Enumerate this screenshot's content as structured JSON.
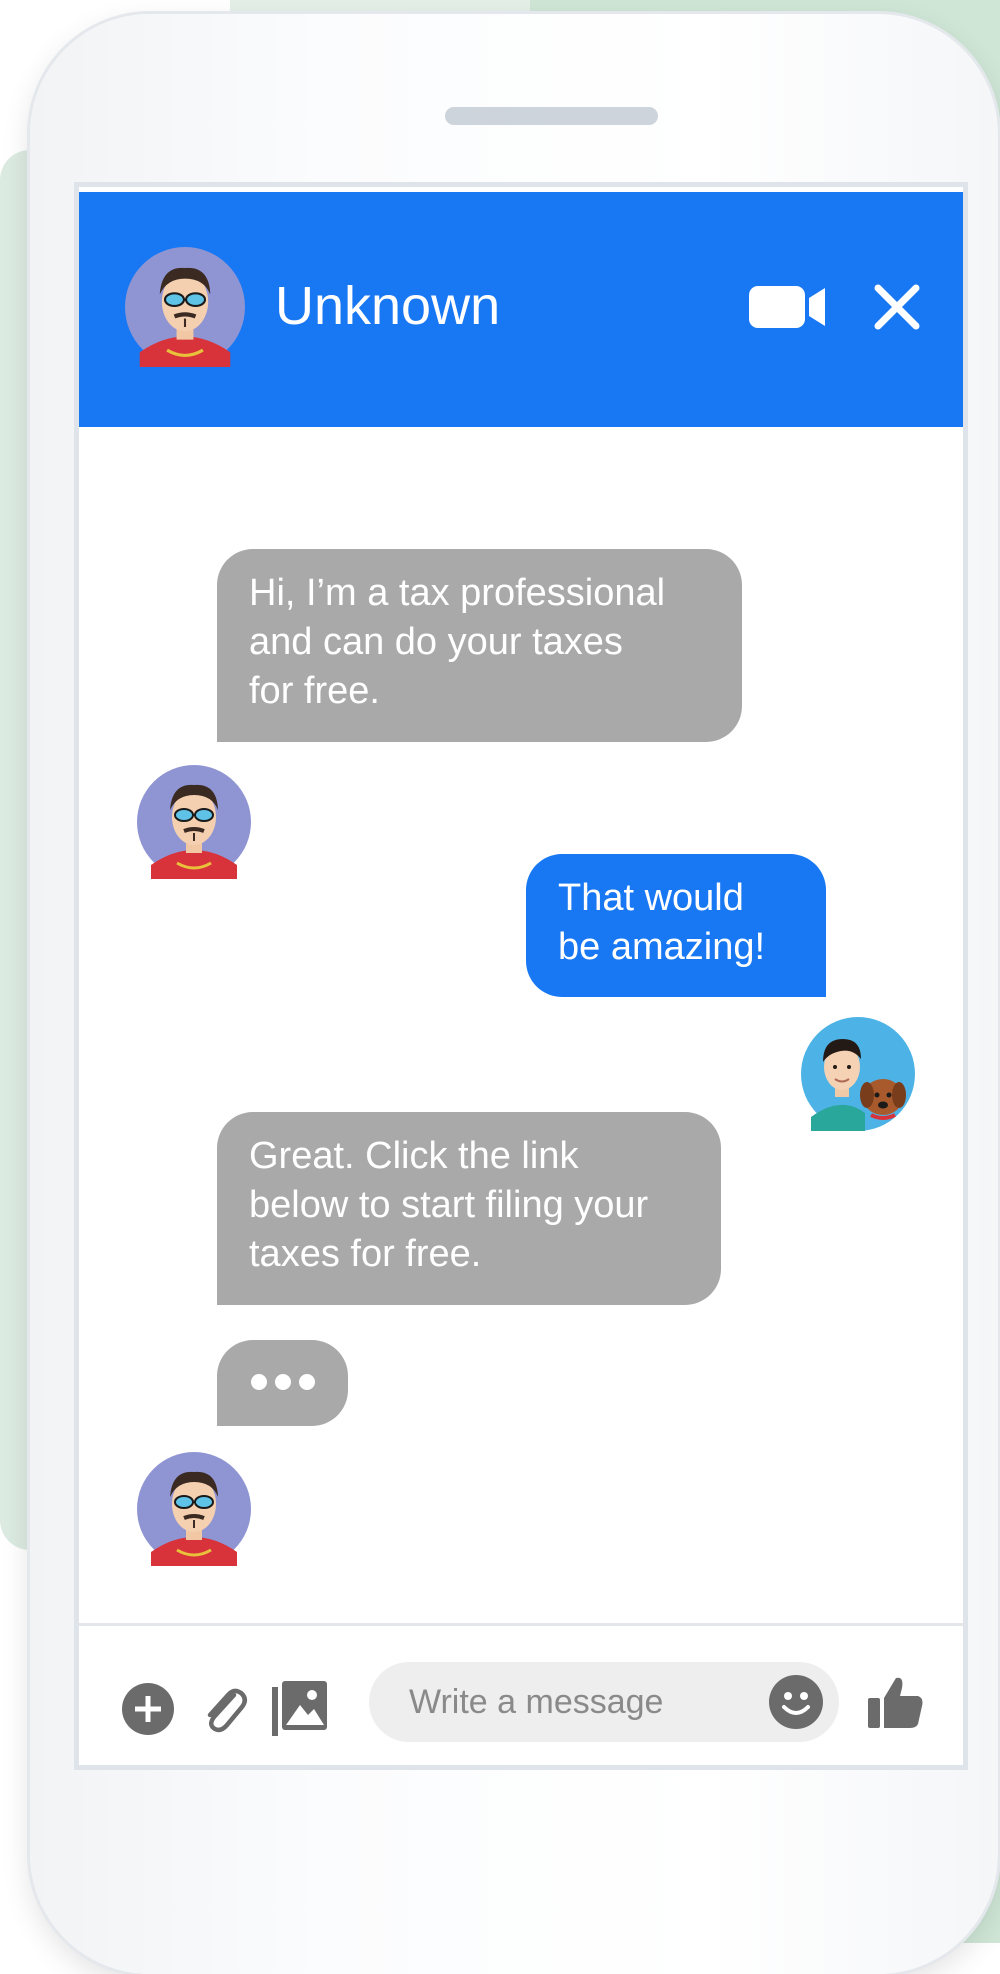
{
  "colors": {
    "brand": "#1877f2",
    "incoming_bubble": "#a9a9a9",
    "composer_icons": "#6b6b6b"
  },
  "header": {
    "contact_name": "Unknown",
    "avatar_icon": "scammer-avatar-icon",
    "actions": [
      "video-call-icon",
      "close-icon"
    ]
  },
  "messages": [
    {
      "direction": "incoming",
      "text": "Hi, I’m a tax professional\nand can do your taxes\nfor free."
    },
    {
      "direction": "outgoing",
      "text": "That would\nbe amazing!"
    },
    {
      "direction": "incoming",
      "text": "Great. Click the link\nbelow to start filing your\ntaxes for free."
    },
    {
      "direction": "incoming",
      "typing": true,
      "icon": "typing-indicator-icon"
    }
  ],
  "composer": {
    "placeholder": "Write a message",
    "icons": [
      "plus-icon",
      "paperclip-icon",
      "image-icon",
      "emoji-icon",
      "thumbs-up-icon"
    ]
  }
}
